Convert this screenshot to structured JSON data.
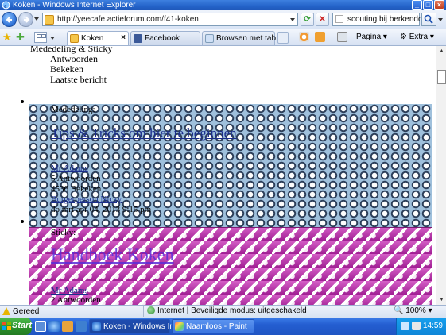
{
  "window": {
    "title": "Koken - Windows Internet Explorer"
  },
  "address_bar": {
    "url": "http://yeecafe.actieforum.com/f41-koken",
    "search_query": "scouting bij berkendonk"
  },
  "tabs": [
    {
      "label": "Koken",
      "active": true
    },
    {
      "label": "Facebook",
      "active": false
    },
    {
      "label": "Browsen met tab...",
      "active": false
    }
  ],
  "command_bar": {
    "page_label": "Pagina",
    "extra_label": "Extra"
  },
  "content": {
    "nested_list": {
      "parent": "Mededeling & Sticky",
      "children": [
        "Antwoorden",
        "Bekeken",
        "Laatste bericht"
      ]
    },
    "topic_1": {
      "tag": "Mededeling:",
      "title": "Tips & Tricks om hier te beginnen",
      "line_by": "Mr Adams",
      "line_replies": "5 Antwoorden",
      "line_views": "4536 Bekeken",
      "last_poster": "Burgerperson Nicky",
      "last_date": "do mrt apr 04, 2013 9:15 pm"
    },
    "topic_2": {
      "tag": "Sticky:",
      "title": "Handboek Koken",
      "line_by": "Mr Adams",
      "line_replies": "2 Antwoorden"
    }
  },
  "status_bar": {
    "status": "Gereed",
    "zone": "Internet | Beveiligde modus: uitgeschakeld",
    "zoom": "100%"
  },
  "taskbar": {
    "start": "Start",
    "items": [
      {
        "label": "Koken - Windows Int...",
        "active": true
      },
      {
        "label": "Naamloos - Paint",
        "active": false
      }
    ],
    "clock": "14:59"
  },
  "colors": {
    "titlebar": "#2463c9",
    "link": "#1a2d8c",
    "pink_icons": "#c23cb2",
    "blue_icons": "#9fc0dc"
  }
}
